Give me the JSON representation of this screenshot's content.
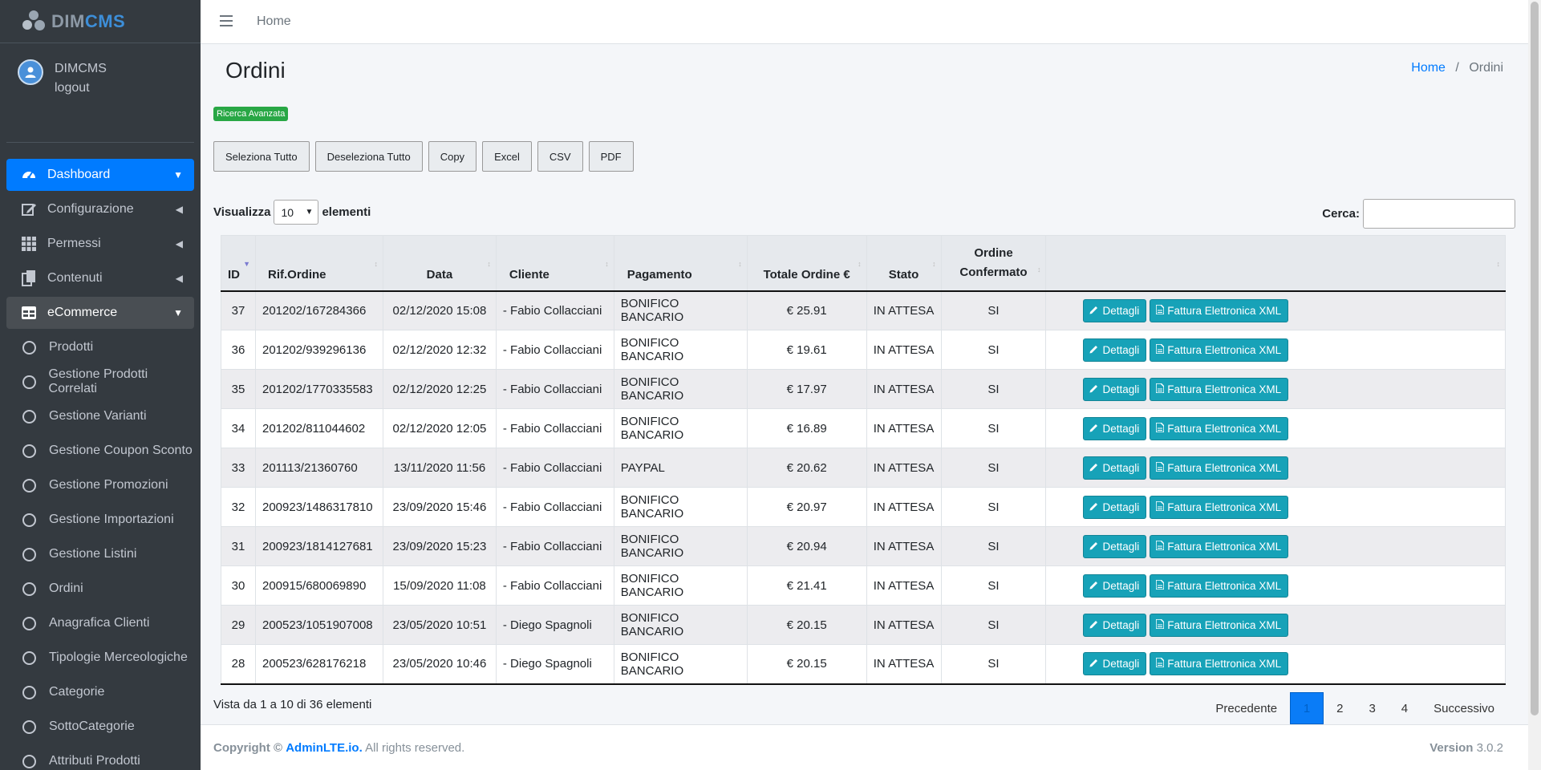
{
  "brand": {
    "part1": "DIM",
    "part2": "CMS"
  },
  "user": {
    "name": "DIMCMS",
    "logout": "logout"
  },
  "sidebar": {
    "items": [
      {
        "label": "Dashboard",
        "icon": "tachometer-icon",
        "state": "active",
        "arrow": "chevron-down"
      },
      {
        "label": "Configurazione",
        "icon": "edit-icon",
        "arrow": "chevron-left"
      },
      {
        "label": "Permessi",
        "icon": "grid-icon",
        "arrow": "chevron-left"
      },
      {
        "label": "Contenuti",
        "icon": "copy-icon",
        "arrow": "chevron-left"
      },
      {
        "label": "eCommerce",
        "icon": "table-icon",
        "state": "open",
        "arrow": "chevron-down"
      }
    ],
    "subitems": [
      "Prodotti",
      "Gestione Prodotti Correlati",
      "Gestione Varianti",
      "Gestione Coupon Sconto",
      "Gestione Promozioni",
      "Gestione Importazioni",
      "Gestione Listini",
      "Ordini",
      "Anagrafica Clienti",
      "Tipologie Merceologiche",
      "Categorie",
      "SottoCategorie",
      "Attributi Prodotti"
    ]
  },
  "header": {
    "home": "Home"
  },
  "page": {
    "title": "Ordini",
    "breadcrumb_home": "Home",
    "breadcrumb_sep": "/",
    "breadcrumb_current": "Ordini"
  },
  "advanced_search": "Ricerca Avanzata",
  "toolbar": [
    "Seleziona Tutto",
    "Deseleziona Tutto",
    "Copy",
    "Excel",
    "CSV",
    "PDF"
  ],
  "length": {
    "prefix": "Visualizza",
    "value": "10",
    "suffix": "elementi"
  },
  "search": {
    "label": "Cerca:",
    "value": ""
  },
  "table": {
    "headers": [
      "ID",
      "Rif.Ordine",
      "Data",
      "Cliente",
      "Pagamento",
      "Totale Ordine €",
      "Stato",
      "Ordine\nConfermato",
      ""
    ],
    "details_label": "Dettagli",
    "invoice_label": "Fattura Elettronica XML",
    "rows": [
      [
        "37",
        "201202/167284366",
        "02/12/2020 15:08",
        "- Fabio Collacciani",
        "BONIFICO BANCARIO",
        "€ 25.91",
        "IN ATTESA",
        "SI"
      ],
      [
        "36",
        "201202/939296136",
        "02/12/2020 12:32",
        "- Fabio Collacciani",
        "BONIFICO BANCARIO",
        "€ 19.61",
        "IN ATTESA",
        "SI"
      ],
      [
        "35",
        "201202/1770335583",
        "02/12/2020 12:25",
        "- Fabio Collacciani",
        "BONIFICO BANCARIO",
        "€ 17.97",
        "IN ATTESA",
        "SI"
      ],
      [
        "34",
        "201202/811044602",
        "02/12/2020 12:05",
        "- Fabio Collacciani",
        "BONIFICO BANCARIO",
        "€ 16.89",
        "IN ATTESA",
        "SI"
      ],
      [
        "33",
        "201113/21360760",
        "13/11/2020 11:56",
        "- Fabio Collacciani",
        "PAYPAL",
        "€ 20.62",
        "IN ATTESA",
        "SI"
      ],
      [
        "32",
        "200923/1486317810",
        "23/09/2020 15:46",
        "- Fabio Collacciani",
        "BONIFICO BANCARIO",
        "€ 20.97",
        "IN ATTESA",
        "SI"
      ],
      [
        "31",
        "200923/1814127681",
        "23/09/2020 15:23",
        "- Fabio Collacciani",
        "BONIFICO BANCARIO",
        "€ 20.94",
        "IN ATTESA",
        "SI"
      ],
      [
        "30",
        "200915/680069890",
        "15/09/2020 11:08",
        "- Fabio Collacciani",
        "BONIFICO BANCARIO",
        "€ 21.41",
        "IN ATTESA",
        "SI"
      ],
      [
        "29",
        "200523/1051907008",
        "23/05/2020 10:51",
        "- Diego Spagnoli",
        "BONIFICO BANCARIO",
        "€ 20.15",
        "IN ATTESA",
        "SI"
      ],
      [
        "28",
        "200523/628176218",
        "23/05/2020 10:46",
        "- Diego Spagnoli",
        "BONIFICO BANCARIO",
        "€ 20.15",
        "IN ATTESA",
        "SI"
      ]
    ]
  },
  "info": "Vista da 1 a 10 di 36 elementi",
  "pagination": {
    "prev": "Precedente",
    "pages": [
      "1",
      "2",
      "3",
      "4"
    ],
    "current": "1",
    "next": "Successivo"
  },
  "footer": {
    "copyright": "Copyright ©",
    "link": "AdminLTE.io.",
    "rights": "All rights reserved.",
    "version_label": "Version",
    "version": "3.0.2"
  },
  "colors": {
    "primary": "#007bff",
    "info": "#17a2b8",
    "success": "#28a745",
    "sidebar": "#343a40"
  }
}
